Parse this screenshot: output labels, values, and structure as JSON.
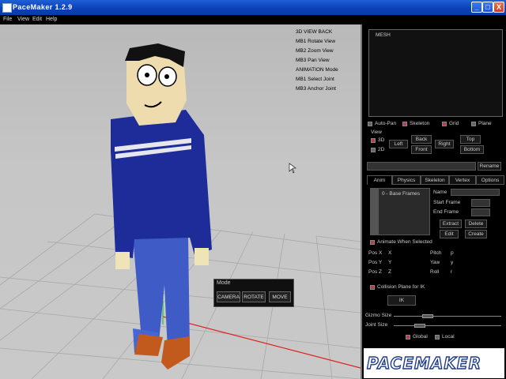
{
  "window": {
    "title": "PaceMaker 1.2.9",
    "minimize": "_",
    "maximize": "□",
    "close": "X"
  },
  "menu": [
    "File",
    "View",
    "Edit",
    "Help"
  ],
  "viewport_help": [
    "3D VIEW  BACK",
    "MB1 Rotate View",
    "MB2 Zoom View",
    "MB3 Pan View",
    "ANIMATION Mode",
    "MB1 Select Joint",
    "MB3 Anchor Joint"
  ],
  "mode_panel": {
    "title": "Mode",
    "buttons": [
      "CAMERA",
      "ROTATE",
      "MOVE"
    ]
  },
  "scene_tree": {
    "items": [
      "MESH"
    ]
  },
  "display_options": [
    {
      "label": "Auto-Pan",
      "checked": false
    },
    {
      "label": "Skeleton",
      "checked": true
    },
    {
      "label": "Grid",
      "checked": true
    },
    {
      "label": "Plane",
      "checked": false
    }
  ],
  "view": {
    "label": "View",
    "modes": [
      {
        "label": "3D",
        "checked": true
      },
      {
        "label": "2D",
        "checked": false
      }
    ],
    "buttons": {
      "left": "Left",
      "back": "Back",
      "front": "Front",
      "right": "Right",
      "top": "Top",
      "bottom": "Bottom"
    }
  },
  "rename_button": "Rename",
  "tabs": [
    "Anim",
    "Physics",
    "Skeleton",
    "Vertex",
    "Options"
  ],
  "anim": {
    "frames": [
      "0 - Base Frames"
    ],
    "name_label": "Name",
    "start_frame_label": "Start Frame",
    "end_frame_label": "End Frame",
    "extract": "Extract",
    "delete": "Delete",
    "edit": "Edit",
    "create": "Create",
    "animate_when_selected": "Animate When Selected",
    "pos_x": "Pos X",
    "pos_x_val": "X",
    "pos_y": "Pos Y",
    "pos_y_val": "Y",
    "pos_z": "Pos Z",
    "pos_z_val": "Z",
    "pitch": "Pitch",
    "pitch_val": "p",
    "yaw": "Yaw",
    "yaw_val": "y",
    "roll": "Roll",
    "roll_val": "r",
    "collision_plane": "Collision Plane for IK",
    "ik": "IK"
  },
  "gizmo_size_label": "Gizmo Size",
  "joint_size_label": "Joint Size",
  "coord_modes": [
    {
      "label": "Global",
      "checked": true
    },
    {
      "label": "Local",
      "checked": false
    }
  ],
  "logo_text": "PACEMAKER",
  "colors": {
    "titlebar": "#0a3fb5",
    "panel_bg": "#000000",
    "checkbox_on": "#b04050",
    "shirt": "#1a2a9a",
    "pants": "#4060c8",
    "shoes": "#c05a20",
    "skin": "#efe0b0"
  }
}
